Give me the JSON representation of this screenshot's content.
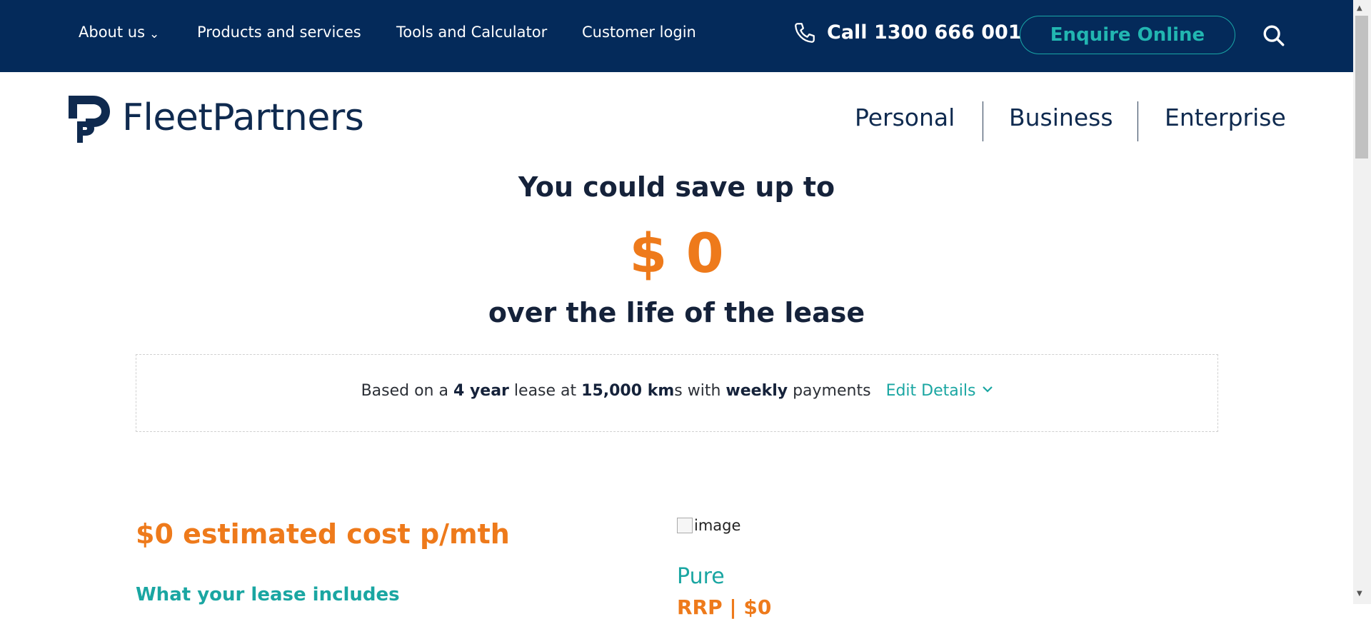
{
  "topnav": {
    "about": "About us",
    "products": "Products and services",
    "tools": "Tools and Calculator",
    "login": "Customer login",
    "call": "Call 1300 666 001",
    "enquire": "Enquire Online"
  },
  "brand": {
    "name": "FleetPartners"
  },
  "segments": [
    "Personal",
    "Business",
    "Enterprise"
  ],
  "hero": {
    "line1": "You could save up to",
    "amount": "$ 0",
    "line2": "over the life of the lease"
  },
  "lease": {
    "prefix": "Based on a",
    "term": "4 year",
    "mid1": "lease at",
    "km": "15,000 km",
    "mid2": "s with",
    "freq": "weekly",
    "suffix": "payments",
    "edit": "Edit Details"
  },
  "summary": {
    "cost": "$0 estimated cost p/mth",
    "includes_heading": "What your lease includes"
  },
  "vehicle": {
    "image_alt": "image",
    "variant": "Pure",
    "rrp": "RRP | $0"
  },
  "colors": {
    "navy": "#042a5a",
    "teal": "#1aa6a2",
    "orange": "#ee7a1b"
  }
}
